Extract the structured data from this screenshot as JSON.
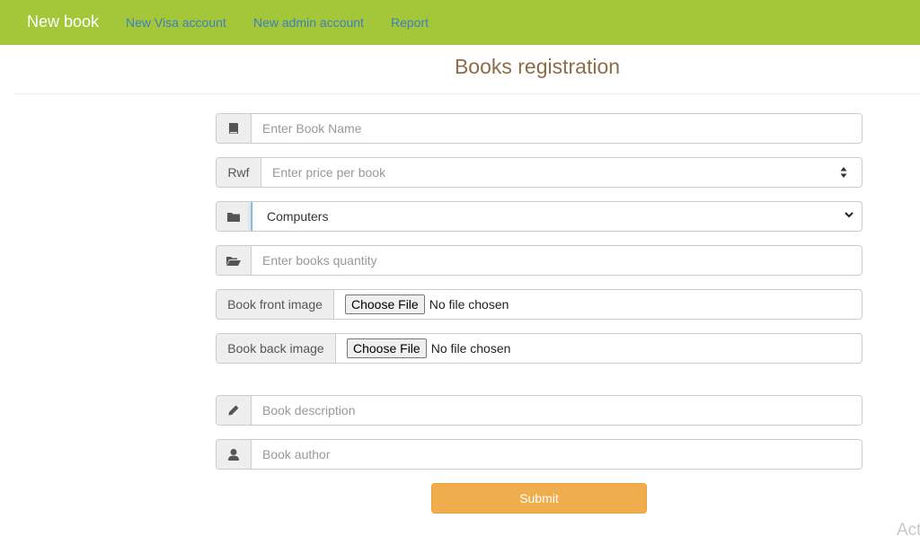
{
  "navbar": {
    "brand": "New book",
    "links": [
      "New Visa account",
      "New admin account",
      "Report"
    ],
    "bg_color": "#a4c639"
  },
  "page": {
    "title": "Books registration"
  },
  "form": {
    "book_name": {
      "placeholder": "Enter Book Name",
      "icon": "book-icon"
    },
    "price": {
      "addon": "Rwf",
      "placeholder": "Enter price per book"
    },
    "category": {
      "selected": "Computers",
      "icon": "folder-icon"
    },
    "quantity": {
      "placeholder": "Enter books quantity",
      "icon": "folder-open-icon"
    },
    "front_image": {
      "label": "Book front image",
      "button": "Choose File",
      "status": "No file chosen"
    },
    "back_image": {
      "label": "Book back image",
      "button": "Choose File",
      "status": "No file chosen"
    },
    "description": {
      "placeholder": "Book description",
      "icon": "pencil-icon"
    },
    "author": {
      "placeholder": "Book author",
      "icon": "user-icon"
    },
    "submit_label": "Submit",
    "submit_color": "#f0ad4e"
  },
  "watermark": "Act"
}
